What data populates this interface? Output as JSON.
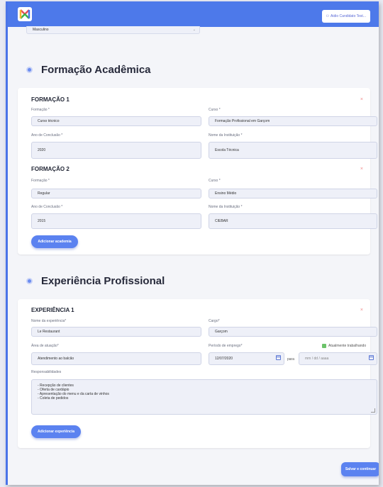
{
  "header": {
    "user_button_label": "Aidio Candidato Test...",
    "user_icon": "user-icon"
  },
  "gender_select": {
    "value": "Masculino"
  },
  "academic": {
    "section_title": "Formação Acadêmica",
    "entries": [
      {
        "title": "FORMAÇÃO 1",
        "formacao_label": "Formação *",
        "formacao_value": "Curso técnico",
        "curso_label": "Curso *",
        "curso_value": "Formação Profissional em Garçom",
        "ano_label": "Ano de Conclusão *",
        "ano_value": "2020",
        "instituicao_label": "Nome da Instituição *",
        "instituicao_value": "Escola Técnica"
      },
      {
        "title": "FORMAÇÃO 2",
        "formacao_label": "Formação *",
        "formacao_value": "Regular",
        "curso_label": "Curso *",
        "curso_value": "Ensino Médio",
        "ano_label": "Ano de Conclusão *",
        "ano_value": "2015",
        "instituicao_label": "Nome da Instituição *",
        "instituicao_value": "CIEBAR"
      }
    ],
    "add_button_label": "Adicionar academia",
    "remove_symbol": "×"
  },
  "experience": {
    "section_title": "Experiência Profissional",
    "entries": [
      {
        "title": "EXPERIÊNCIA 1",
        "empresa_label": "Nome da experiência*",
        "empresa_value": "Le Restaurant",
        "cargo_label": "Cargo*",
        "cargo_value": "Garçom",
        "area_label": "Área de atuação*",
        "area_value": "Atendimento ao balcão",
        "periodo_label": "Período de emprego*",
        "atual_label": "Atualmente trabalhando",
        "data_inicio": "12/07/2020",
        "para_label": "para",
        "data_fim_placeholder": "mm / dd / aaaa",
        "responsabilidades_label": "Responsabilidades",
        "responsabilidades_lines": [
          "- Recepção de clientes",
          "- Oferta de cardápio",
          "- Apresentação do menu e da carta de vinhos",
          "- Coleta de pedidos"
        ]
      }
    ],
    "add_button_label": "Adicionar experiência",
    "remove_symbol": "×"
  },
  "footer": {
    "save_button_label": "Salvar e continuar"
  },
  "colors": {
    "accent": "#4d79ea",
    "button": "#5b82f0",
    "checkbox": "#6cc36a",
    "remove": "#f08a8a"
  }
}
